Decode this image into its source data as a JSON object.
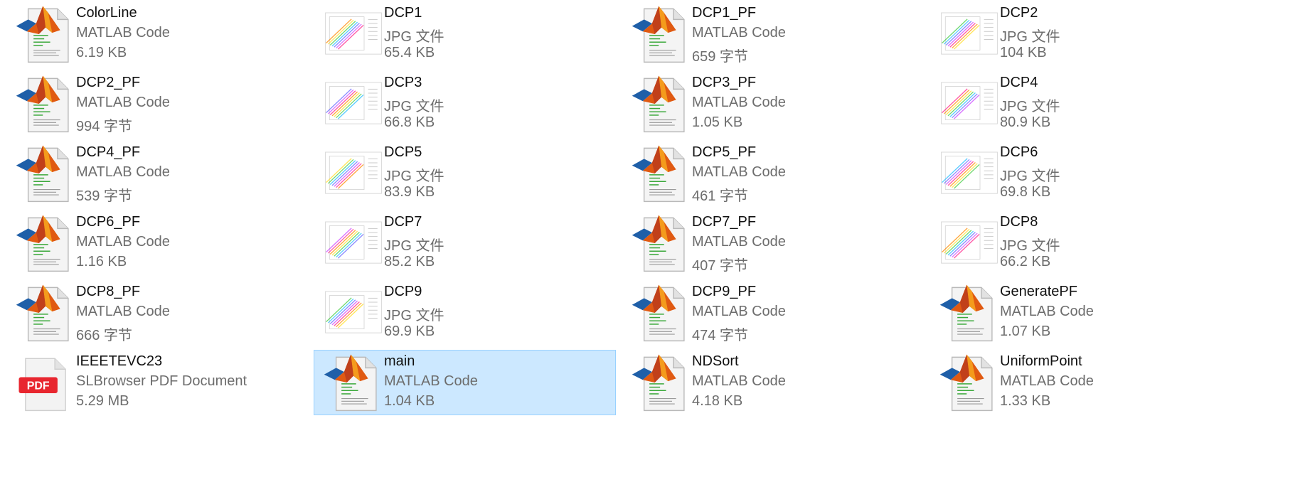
{
  "explorer": {
    "selected_index": 21,
    "files": [
      {
        "name": "ColorLine",
        "type": "MATLAB Code",
        "size": "6.19 KB",
        "icon": "matlab-file-icon"
      },
      {
        "name": "DCP1",
        "type": "JPG 文件",
        "size": "65.4 KB",
        "icon": "jpg-thumbnail-icon"
      },
      {
        "name": "DCP1_PF",
        "type": "MATLAB Code",
        "size": "659 字节",
        "icon": "matlab-file-icon"
      },
      {
        "name": "DCP2",
        "type": "JPG 文件",
        "size": "104 KB",
        "icon": "jpg-thumbnail-icon"
      },
      {
        "name": "DCP2_PF",
        "type": "MATLAB Code",
        "size": "994 字节",
        "icon": "matlab-file-icon"
      },
      {
        "name": "DCP3",
        "type": "JPG 文件",
        "size": "66.8 KB",
        "icon": "jpg-thumbnail-icon"
      },
      {
        "name": "DCP3_PF",
        "type": "MATLAB Code",
        "size": "1.05 KB",
        "icon": "matlab-file-icon"
      },
      {
        "name": "DCP4",
        "type": "JPG 文件",
        "size": "80.9 KB",
        "icon": "jpg-thumbnail-icon"
      },
      {
        "name": "DCP4_PF",
        "type": "MATLAB Code",
        "size": "539 字节",
        "icon": "matlab-file-icon"
      },
      {
        "name": "DCP5",
        "type": "JPG 文件",
        "size": "83.9 KB",
        "icon": "jpg-thumbnail-icon"
      },
      {
        "name": "DCP5_PF",
        "type": "MATLAB Code",
        "size": "461 字节",
        "icon": "matlab-file-icon"
      },
      {
        "name": "DCP6",
        "type": "JPG 文件",
        "size": "69.8 KB",
        "icon": "jpg-thumbnail-icon"
      },
      {
        "name": "DCP6_PF",
        "type": "MATLAB Code",
        "size": "1.16 KB",
        "icon": "matlab-file-icon"
      },
      {
        "name": "DCP7",
        "type": "JPG 文件",
        "size": "85.2 KB",
        "icon": "jpg-thumbnail-icon"
      },
      {
        "name": "DCP7_PF",
        "type": "MATLAB Code",
        "size": "407 字节",
        "icon": "matlab-file-icon"
      },
      {
        "name": "DCP8",
        "type": "JPG 文件",
        "size": "66.2 KB",
        "icon": "jpg-thumbnail-icon"
      },
      {
        "name": "DCP8_PF",
        "type": "MATLAB Code",
        "size": "666 字节",
        "icon": "matlab-file-icon"
      },
      {
        "name": "DCP9",
        "type": "JPG 文件",
        "size": "69.9 KB",
        "icon": "jpg-thumbnail-icon"
      },
      {
        "name": "DCP9_PF",
        "type": "MATLAB Code",
        "size": "474 字节",
        "icon": "matlab-file-icon"
      },
      {
        "name": "GeneratePF",
        "type": "MATLAB Code",
        "size": "1.07 KB",
        "icon": "matlab-file-icon"
      },
      {
        "name": "IEEETEVC23",
        "type": "SLBrowser PDF Document",
        "size": "5.29 MB",
        "icon": "pdf-file-icon",
        "badge": "PDF"
      },
      {
        "name": "main",
        "type": "MATLAB Code",
        "size": "1.04 KB",
        "icon": "matlab-file-icon"
      },
      {
        "name": "NDSort",
        "type": "MATLAB Code",
        "size": "4.18 KB",
        "icon": "matlab-file-icon"
      },
      {
        "name": "UniformPoint",
        "type": "MATLAB Code",
        "size": "1.33 KB",
        "icon": "matlab-file-icon"
      }
    ]
  },
  "colors": {
    "selection_bg": "#cce8ff",
    "selection_border": "#99d1ff",
    "name_text": "#111111",
    "detail_text": "#6d6d6d",
    "pdf_red": "#e8262f"
  }
}
